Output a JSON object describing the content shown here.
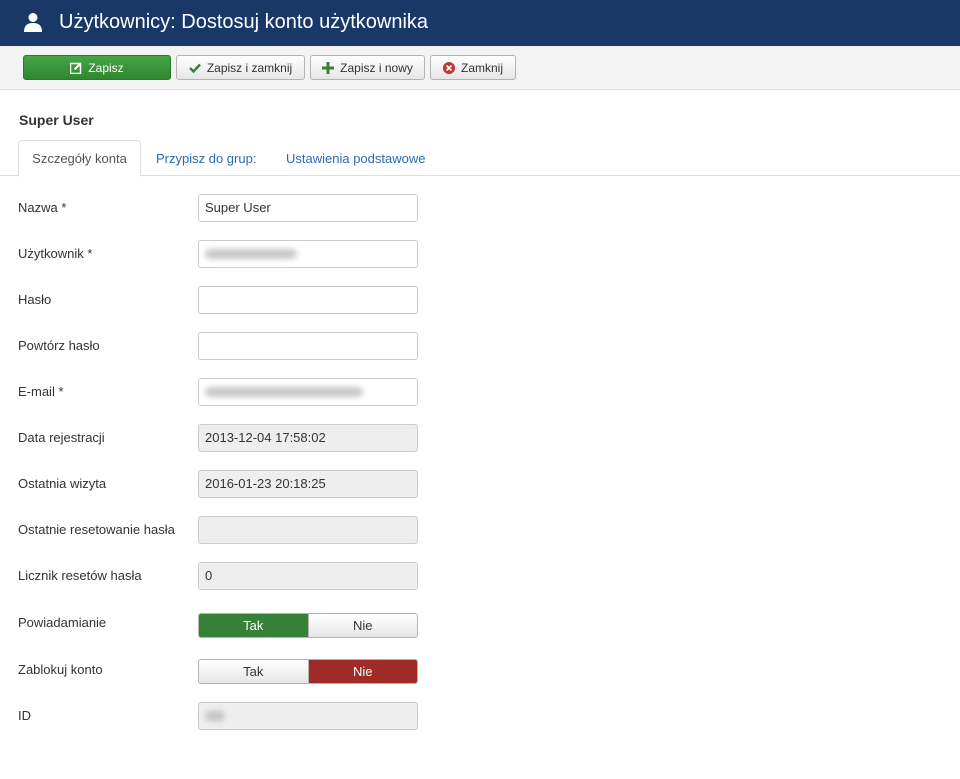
{
  "header": {
    "title": "Użytkownicy: Dostosuj konto użytkownika",
    "icon": "user-icon"
  },
  "toolbar": {
    "save_label": "Zapisz",
    "save_close_label": "Zapisz i zamknij",
    "save_new_label": "Zapisz i nowy",
    "close_label": "Zamknij"
  },
  "user_heading": "Super User",
  "tabs": [
    {
      "label": "Szczegóły konta",
      "active": true
    },
    {
      "label": "Przypisz do grup:",
      "active": false
    },
    {
      "label": "Ustawienia podstawowe",
      "active": false
    }
  ],
  "form": {
    "name": {
      "label": "Nazwa *",
      "value": "Super User"
    },
    "username": {
      "label": "Użytkownik *",
      "value": ""
    },
    "password": {
      "label": "Hasło",
      "value": ""
    },
    "password2": {
      "label": "Powtórz hasło",
      "value": ""
    },
    "email": {
      "label": "E-mail *",
      "value": ""
    },
    "register_date": {
      "label": "Data rejestracji",
      "value": "2013-12-04 17:58:02"
    },
    "last_visit": {
      "label": "Ostatnia wizyta",
      "value": "2016-01-23 20:18:25"
    },
    "last_reset": {
      "label": "Ostatnie resetowanie hasła",
      "value": ""
    },
    "reset_count": {
      "label": "Licznik resetów hasła",
      "value": "0"
    },
    "send_email": {
      "label": "Powiadamianie",
      "yes": "Tak",
      "no": "Nie",
      "selected": "Tak"
    },
    "block": {
      "label": "Zablokuj konto",
      "yes": "Tak",
      "no": "Nie",
      "selected": "Nie"
    },
    "id": {
      "label": "ID",
      "value": ""
    }
  },
  "colors": {
    "header_bg": "#1a3867",
    "save_green": "#378137",
    "toggle_red": "#a02a26",
    "link_blue": "#2a69b8"
  }
}
